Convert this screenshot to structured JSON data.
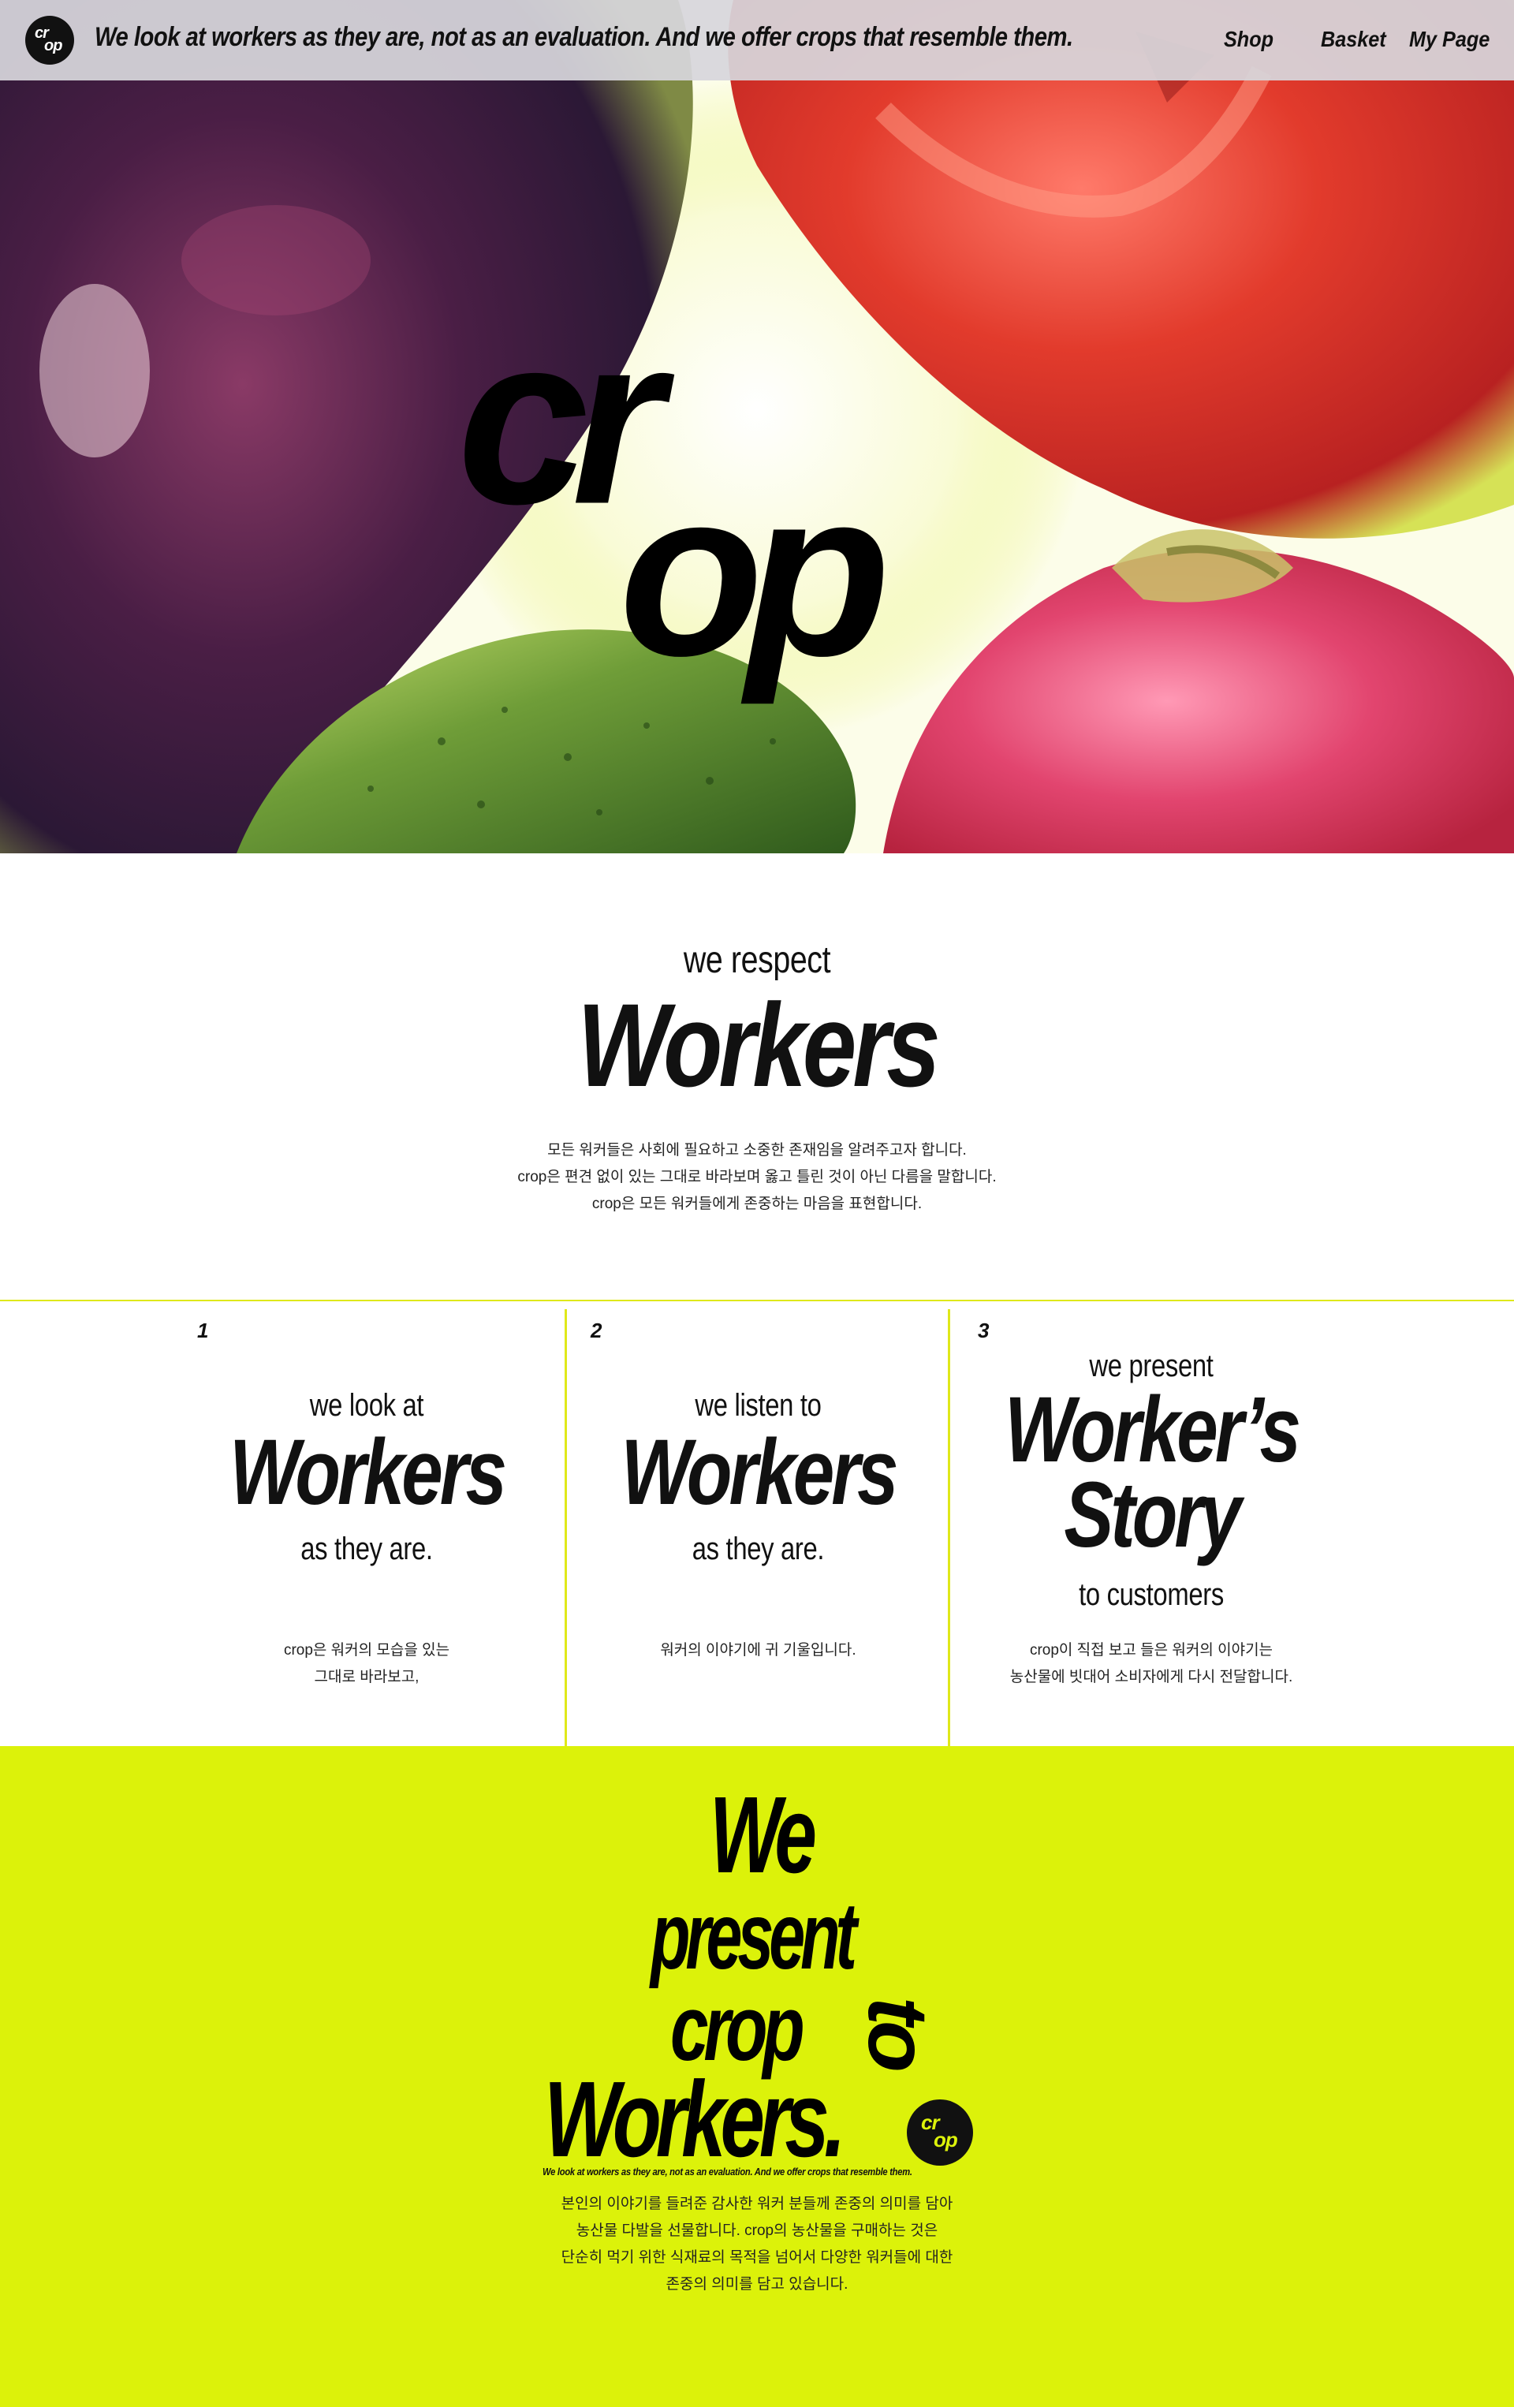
{
  "header": {
    "logo_line1": "cr",
    "logo_line2": "op",
    "tagline": "We look at workers as they are, not as an evaluation. And we offer crops that resemble them.",
    "nav": [
      {
        "label": "Shop"
      },
      {
        "label": "Basket"
      },
      {
        "label": "My Page"
      }
    ]
  },
  "hero": {
    "logo_top": "cr",
    "logo_bottom": "op"
  },
  "respect": {
    "kicker": "we respect",
    "title": "Workers",
    "body": [
      "모든 워커들은 사회에 필요하고 소중한 존재임을 알려주고자 합니다.",
      "crop은 편견 없이 있는 그대로 바라보며 옳고 틀린 것이 아닌 다름을 말합니다.",
      "crop은 모든 워커들에게 존중하는 마음을 표현합니다."
    ]
  },
  "columns": [
    {
      "number": "1",
      "top": "we look at",
      "big": [
        "Workers"
      ],
      "bottom": "as they are.",
      "body": [
        "crop은 워커의 모습을 있는",
        "그대로 바라보고,"
      ]
    },
    {
      "number": "2",
      "top": "we listen to",
      "big": [
        "Workers"
      ],
      "bottom": "as they are.",
      "body": [
        "워커의 이야기에 귀 기울입니다."
      ]
    },
    {
      "number": "3",
      "top": "we present",
      "big": [
        "Worker’s",
        "Story"
      ],
      "bottom": "to customers",
      "body": [
        "crop이 직접 보고 들은 워커의 이야기는",
        "농산물에 빗대어 소비자에게 다시 전달합니다."
      ]
    }
  ],
  "poster": {
    "line_we": "We",
    "line_present": "present",
    "line_crop": "crop",
    "line_to": "to",
    "line_workers": "Workers.",
    "badge_line1": "cr",
    "badge_line2": "op",
    "tagline": "We look at workers as they are, not as an evaluation. And we offer crops that resemble them.",
    "body": [
      "본인의 이야기를 들려준 감사한 워커 분들께 존중의 의미를 담아",
      "농산물 다발을 선물합니다. crop의 농산물을 구매하는 것은",
      "단순히 먹기 위한 식재료의 목적을 넘어서 다양한 워커들에 대한",
      "존중의 의미를 담고 있습니다."
    ]
  },
  "colors": {
    "accent_yellow": "#dcf20a",
    "divider_yellow": "#dfe81a",
    "header_bg": "#d7d6dc",
    "text": "#111111"
  },
  "icons": [
    "crop-logo-icon"
  ]
}
